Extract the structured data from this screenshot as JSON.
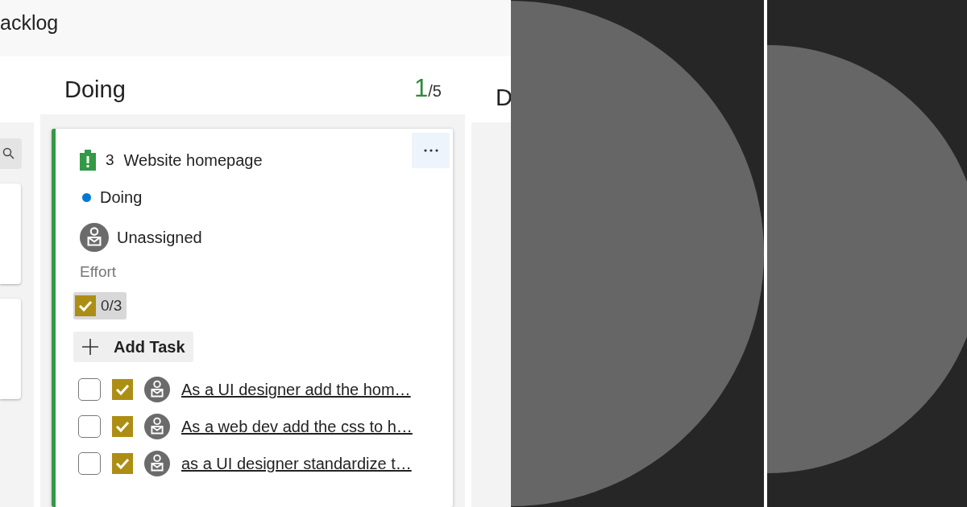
{
  "header": {
    "title": "acklog"
  },
  "doing_column": {
    "title": "Doing",
    "count": "1",
    "limit": "/5"
  },
  "next_column": {
    "title": "D"
  },
  "card": {
    "id": "3",
    "title": "Website homepage",
    "state": "Doing",
    "assignee": "Unassigned",
    "effort_label": "Effort",
    "task_summary": "0/3",
    "add_task": "Add Task",
    "tasks": [
      {
        "title": "As a UI designer add the hom…",
        "checked": false
      },
      {
        "title": "As a web dev add the css to h…",
        "checked": false
      },
      {
        "title": "as a UI designer standardize t…",
        "checked": false
      }
    ]
  }
}
